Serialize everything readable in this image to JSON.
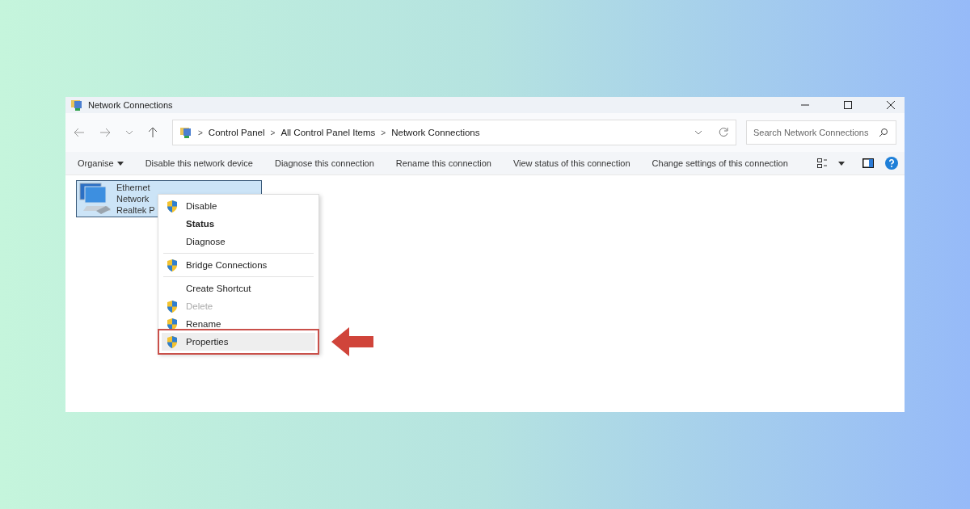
{
  "window": {
    "title": "Network Connections"
  },
  "address": {
    "crumbs": [
      "Control Panel",
      "All Control Panel Items",
      "Network Connections"
    ],
    "separator": ">"
  },
  "search": {
    "placeholder": "Search Network Connections"
  },
  "toolbar": [
    {
      "label": "Organise",
      "kind": "menu"
    },
    {
      "label": "Disable this network device",
      "kind": "command"
    },
    {
      "label": "Diagnose this connection",
      "kind": "command"
    },
    {
      "label": "Rename this connection",
      "kind": "command"
    },
    {
      "label": "View status of this connection",
      "kind": "command"
    },
    {
      "label": "Change settings of this connection",
      "kind": "command"
    }
  ],
  "connections": [
    {
      "name": "Ethernet",
      "lines": [
        "Network",
        "Realtek P"
      ],
      "selected": true
    }
  ],
  "context_menu": [
    {
      "label": "Disable",
      "shield": true,
      "bold": false,
      "disabled": false,
      "selected": false,
      "divider_after": false,
      "callout": false
    },
    {
      "label": "Status",
      "shield": false,
      "bold": true,
      "disabled": false,
      "selected": false,
      "divider_after": false,
      "callout": false
    },
    {
      "label": "Diagnose",
      "shield": false,
      "bold": false,
      "disabled": false,
      "selected": false,
      "divider_after": true,
      "callout": false
    },
    {
      "label": "Bridge Connections",
      "shield": true,
      "bold": false,
      "disabled": false,
      "selected": false,
      "divider_after": true,
      "callout": false
    },
    {
      "label": "Create Shortcut",
      "shield": false,
      "bold": false,
      "disabled": false,
      "selected": false,
      "divider_after": false,
      "callout": false
    },
    {
      "label": "Delete",
      "shield": true,
      "bold": false,
      "disabled": true,
      "selected": false,
      "divider_after": false,
      "callout": false
    },
    {
      "label": "Rename",
      "shield": true,
      "bold": false,
      "disabled": false,
      "selected": false,
      "divider_after": false,
      "callout": false
    },
    {
      "label": "Properties",
      "shield": true,
      "bold": false,
      "disabled": false,
      "selected": true,
      "divider_after": false,
      "callout": true
    }
  ]
}
